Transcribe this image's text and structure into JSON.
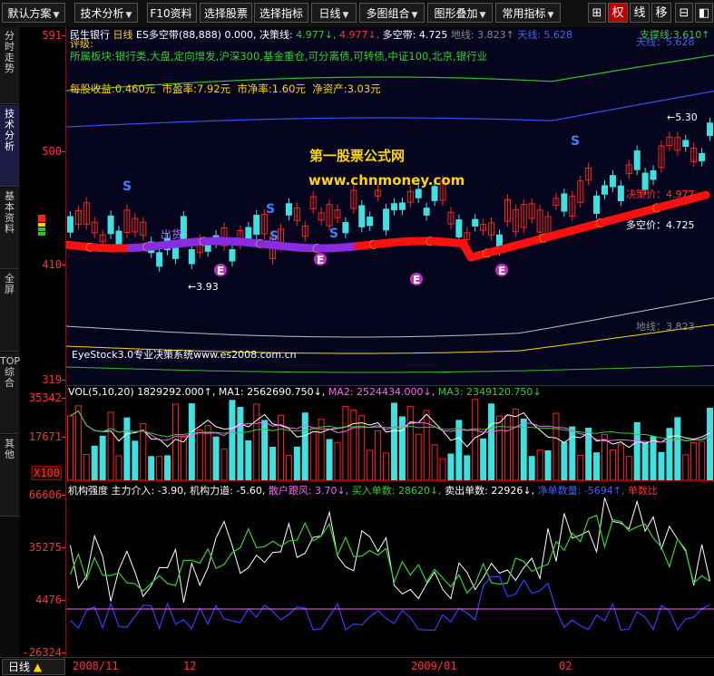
{
  "toolbar": {
    "buttons": [
      {
        "label": "默认方案",
        "arrow": "▼"
      },
      {
        "label": "技术分析",
        "arrow": "▼"
      },
      {
        "label": "F10资料",
        "arrow": ""
      },
      {
        "label": "选择股票",
        "arrow": "▼"
      },
      {
        "label": "选择指标",
        "arrow": "▼"
      },
      {
        "label": "日线",
        "arrow": "▼"
      },
      {
        "label": "多图组合",
        "arrow": "▼"
      },
      {
        "label": "图形叠加",
        "arrow": "▼"
      },
      {
        "label": "常用指标",
        "arrow": "▼"
      }
    ],
    "icons": [
      "⊞",
      "权",
      "线",
      "移",
      "⊟",
      "◧"
    ]
  },
  "left_tabs": [
    "分时走势",
    "技术分析",
    "基本资料",
    "全屏",
    "TOP综合",
    "其他"
  ],
  "price_axis": {
    "max": "591",
    "v500": "500",
    "v410": "410",
    "min": "319"
  },
  "vol_axis": {
    "top": "35342",
    "mid": "17671",
    "unit": "X100"
  },
  "ind_axis": {
    "top": "66606",
    "v2": "35275",
    "v3": "4476",
    "bottom": "-26324"
  },
  "main_info": {
    "stock": "民生银行",
    "period": "日线",
    "indicator": "ES多空带",
    "params": "(88,888)",
    "val0": "0.000,",
    "decision_label": "决策线:",
    "decision_val1": "4.977↓,",
    "decision_val2": "4.977↓,",
    "long_short_label": "多空带:",
    "long_short_val": "4.725",
    "ground_label": "地线:",
    "ground_val": "3.823↑",
    "sky_label": "天线:",
    "sky_val": "5.628",
    "support_label": "支撑线:",
    "support_val": "3.610↑",
    "rating": "评级:",
    "sector": "所属板块:银行类,大盘,定向增发,沪深300,基金重仓,可分离债,可转债,中证100,北京,银行业",
    "eps": "每股收益:0.460元",
    "pe": "市盈率:7.92元",
    "pb": "市净率:1.60元",
    "nav": "净资产:3.03元",
    "watermark_cn": "第一股票公式网",
    "watermark_url": "www.chnmoney.com",
    "system_text": "EyeStock3.0专业决策系统www.es2008.com.cn",
    "high_label": "←5.30",
    "low_label": "←3.93",
    "sell_label": "出货",
    "decision_price": "决策价：4.977",
    "long_short_price": "多空价：4.725",
    "ground_right": "地线：3.823",
    "sky_right": "天线：5.628"
  },
  "vol_info": {
    "name": "VOL(5,10,20)",
    "v": "1829292.000↑,",
    "ma1": "MA1: 2562690.750↓,",
    "ma2": "MA2: 2524434.000↓,",
    "ma3": "MA3: 2349120.750↓"
  },
  "ind_info": {
    "name": "机构强度",
    "main": "主力介入: -3.90,",
    "force": "机构力道: -5.60,",
    "retail": "散户跟风: 3.70↓,",
    "buy": "买入单数: 28620↓,",
    "sell": "卖出单数: 22926↓,",
    "net": "净单数量: -5694↑,",
    "ratio": "单数比"
  },
  "dates": [
    "2008/11",
    "12",
    "2009/01",
    "02"
  ],
  "bottom_period": "日线",
  "colors": {
    "up": "#ff2020",
    "down": "#40e0e0",
    "band_up": "#ff1010",
    "band_down": "#8a2be2",
    "accent": "#c00000"
  }
}
